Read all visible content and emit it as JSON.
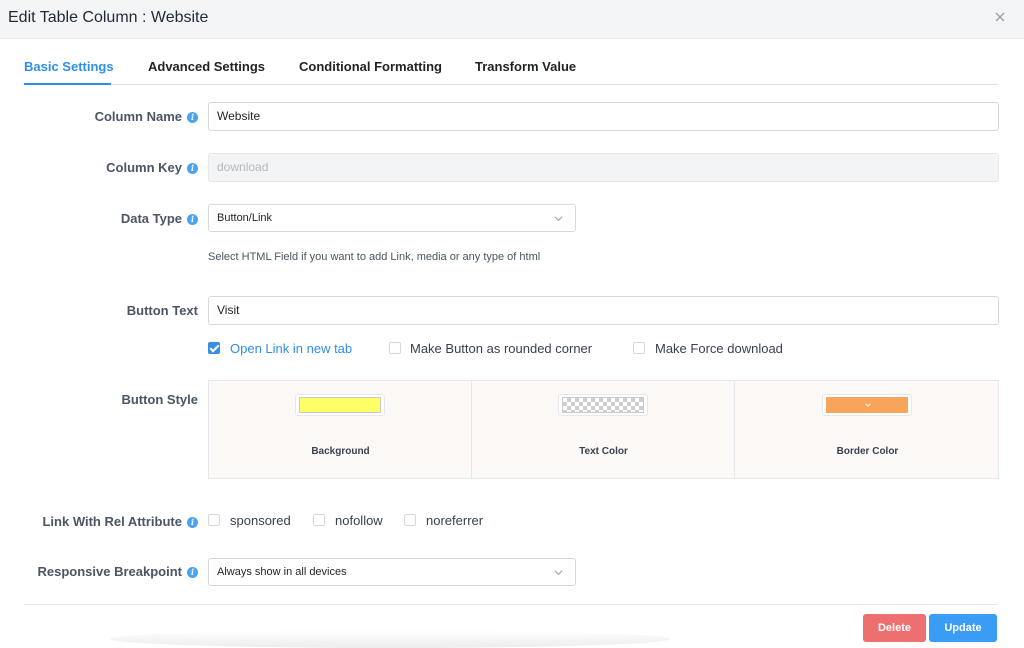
{
  "dialog": {
    "title": "Edit Table Column : Website"
  },
  "tabs": [
    {
      "label": "Basic Settings",
      "active": true
    },
    {
      "label": "Advanced Settings",
      "active": false
    },
    {
      "label": "Conditional Formatting",
      "active": false
    },
    {
      "label": "Transform Value",
      "active": false
    }
  ],
  "fields": {
    "column_name": {
      "label": "Column Name",
      "value": "Website"
    },
    "column_key": {
      "label": "Column Key",
      "placeholder": "download"
    },
    "data_type": {
      "label": "Data Type",
      "value": "Button/Link",
      "help": "Select HTML Field if you want to add Link, media or any type of html"
    },
    "button_text": {
      "label": "Button Text",
      "value": "Visit"
    }
  },
  "options": {
    "open_new_tab": {
      "label": "Open Link in new tab",
      "checked": true
    },
    "rounded": {
      "label": "Make Button as rounded corner",
      "checked": false
    },
    "force_download": {
      "label": "Make Force download",
      "checked": false
    }
  },
  "button_style": {
    "label": "Button Style",
    "background": {
      "label": "Background",
      "color": "#ffff66"
    },
    "text_color": {
      "label": "Text Color",
      "color": "transparent"
    },
    "border_color": {
      "label": "Border Color",
      "color": "#f7a55a"
    }
  },
  "rel": {
    "label": "Link With Rel Attribute",
    "sponsored": {
      "label": "sponsored",
      "checked": false
    },
    "nofollow": {
      "label": "nofollow",
      "checked": false
    },
    "noreferrer": {
      "label": "noreferrer",
      "checked": false
    }
  },
  "breakpoint": {
    "label": "Responsive Breakpoint",
    "value": "Always show in all devices"
  },
  "footer": {
    "delete_label": "Delete",
    "update_label": "Update"
  },
  "colors": {
    "accent": "#2f8fe6",
    "delete": "#ee6f6f",
    "update": "#3b9cf5"
  }
}
